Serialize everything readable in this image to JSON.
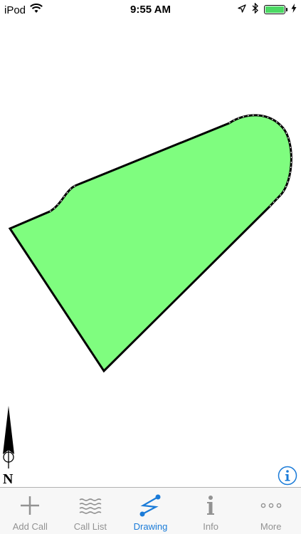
{
  "status_bar": {
    "carrier": "iPod",
    "time": "9:55 AM",
    "battery_color": "#4cd964"
  },
  "drawing": {
    "fill_color": "#7ffd7f",
    "stroke_color": "#000000",
    "compass_label": "N"
  },
  "info_button": {
    "icon": "info-icon",
    "color": "#1a7bd8"
  },
  "tab_bar": {
    "active_color": "#1a7bd8",
    "inactive_color": "#929292",
    "tabs": [
      {
        "label": "Add Call",
        "icon": "plus-icon",
        "active": false
      },
      {
        "label": "Call List",
        "icon": "wavy-lines-icon",
        "active": false
      },
      {
        "label": "Drawing",
        "icon": "drawing-path-icon",
        "active": true
      },
      {
        "label": "Info",
        "icon": "info-letter-icon",
        "active": false
      },
      {
        "label": "More",
        "icon": "more-dots-icon",
        "active": false
      }
    ]
  }
}
